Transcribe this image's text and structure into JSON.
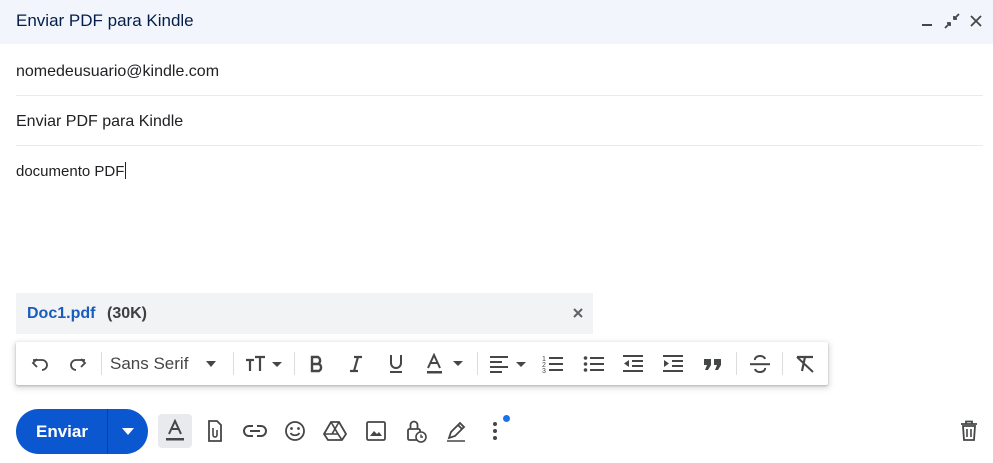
{
  "header": {
    "title": "Enviar PDF para Kindle"
  },
  "to": {
    "value": "nomedeusuario@kindle.com"
  },
  "subject": {
    "value": "Enviar PDF para Kindle"
  },
  "body": {
    "text": "documento PDF"
  },
  "attachment": {
    "name": "Doc1.pdf",
    "size": "(30K)"
  },
  "toolbar": {
    "font": "Sans Serif"
  },
  "send": {
    "label": "Enviar"
  },
  "colors": {
    "send": "#0b57d0",
    "header_bg": "#f2f6fc",
    "link": "#1a5bbf"
  }
}
